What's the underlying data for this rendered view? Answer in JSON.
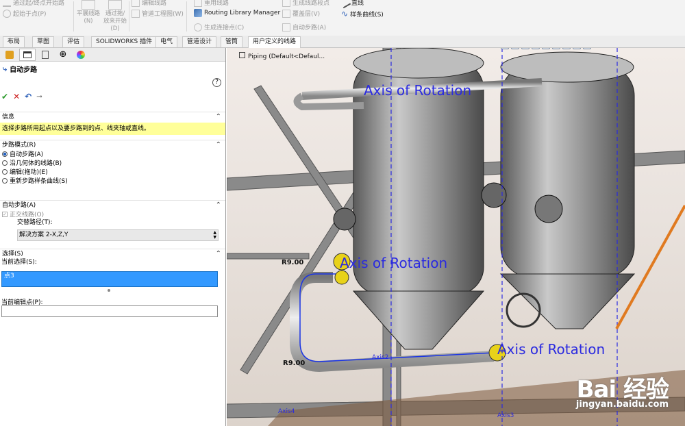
{
  "ribbon": {
    "cut_top_left": "通过起/终点开始路",
    "start_at_point": "起始于点(P)",
    "flat_route": "平展线路(N)",
    "route_through_drag": "通过拖/放来开始(D)",
    "cut_top_mid": "编辑线路",
    "tube_drawing": "管道工程图(W)",
    "routing_library_manager": "Routing Library Manager",
    "create_connection_point": "生成连接点(C)",
    "cut_top_mid2": "重用线路",
    "cover_layer": "覆盖层(V)",
    "auto_route": "自动步路(A)",
    "cut_top_right": "生成线路段点",
    "line": "直线",
    "spline": "样条曲线(S)"
  },
  "tabs": [
    "布局",
    "草图",
    "评估",
    "SOLIDWORKS 插件",
    "电气",
    "管道设计",
    "管筒",
    "用户定义的线路"
  ],
  "active_tab": 7,
  "panel": {
    "title": "自动步路",
    "help": "?",
    "info_header": "信息",
    "info_text": "选择步路所用起点以及要步路到的点、线夹轴或直线。",
    "mode_header": "步路模式(R)",
    "mode_options": [
      "自动步路(A)",
      "沿几何体的线路(B)",
      "编辑(拖动)(E)",
      "重新步路样条曲线(S)"
    ],
    "mode_selected": 0,
    "auto_header": "自动步路(A)",
    "orthogonal": "正交线路(O)",
    "alt_path_label": "交替路径(T):",
    "alt_path_value": "解决方案 2-X,Z,Y",
    "selection_header": "选择(S)",
    "current_selection_label": "当前选择(S):",
    "current_selection_value": "点3",
    "current_edit_label": "当前编辑点(P):",
    "current_edit_value": ""
  },
  "viewport": {
    "breadcrumb": "Piping  (Default<Defaul...",
    "axis_labels": [
      "Axis of Rotation",
      "Axis of Rotation",
      "Axis of Rotation"
    ],
    "small_axes": [
      "Axis2",
      "Axis4",
      "Axis3"
    ],
    "radius_labels": [
      "R9.00",
      "R9.00"
    ],
    "watermark_brand": "Bai 经验",
    "watermark_url": "jingyan.baidu.com"
  },
  "colors": {
    "selection_blue": "#3399ff",
    "info_yellow": "#ffff99",
    "axis_blue": "#2a2ae0",
    "flange_yellow": "#e8d21a"
  }
}
